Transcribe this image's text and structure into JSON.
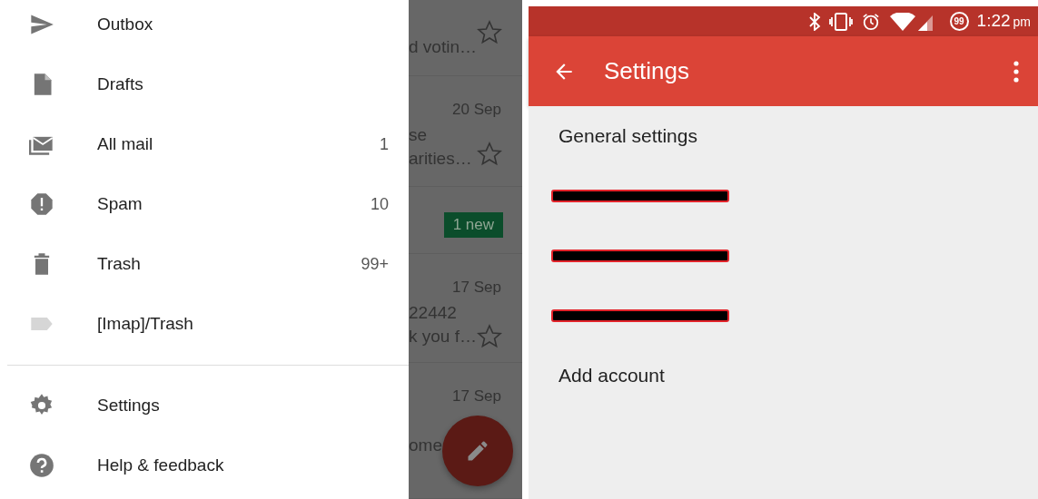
{
  "drawer": {
    "items": [
      {
        "label": "Outbox"
      },
      {
        "label": "Drafts"
      },
      {
        "label": "All mail",
        "count": "1"
      },
      {
        "label": "Spam",
        "count": "10"
      },
      {
        "label": "Trash",
        "count": "99+"
      },
      {
        "label": "[Imap]/Trash"
      }
    ],
    "footer_items": [
      {
        "label": "Settings"
      },
      {
        "label": "Help & feedback"
      }
    ]
  },
  "mail_list": {
    "rows": [
      {
        "kind": "mail",
        "lines": [
          "d votin…"
        ],
        "starred": false
      },
      {
        "kind": "mail",
        "date": "20 Sep",
        "lines": [
          "se",
          "arities…"
        ],
        "starred": false
      },
      {
        "kind": "badge",
        "badge": "1 new"
      },
      {
        "kind": "mail",
        "date": "17 Sep",
        "lines": [
          "22442",
          "k you f…"
        ],
        "starred": false
      },
      {
        "kind": "mail",
        "date": "17 Sep",
        "lines": [
          "ome"
        ]
      }
    ]
  },
  "status_bar": {
    "battery": "99",
    "time": "1:22",
    "ampm": "pm"
  },
  "app_bar": {
    "title": "Settings"
  },
  "settings": {
    "items": [
      {
        "kind": "text",
        "label": "General settings"
      },
      {
        "kind": "redacted"
      },
      {
        "kind": "redacted"
      },
      {
        "kind": "redacted"
      },
      {
        "kind": "action",
        "label": "Add account"
      }
    ]
  }
}
